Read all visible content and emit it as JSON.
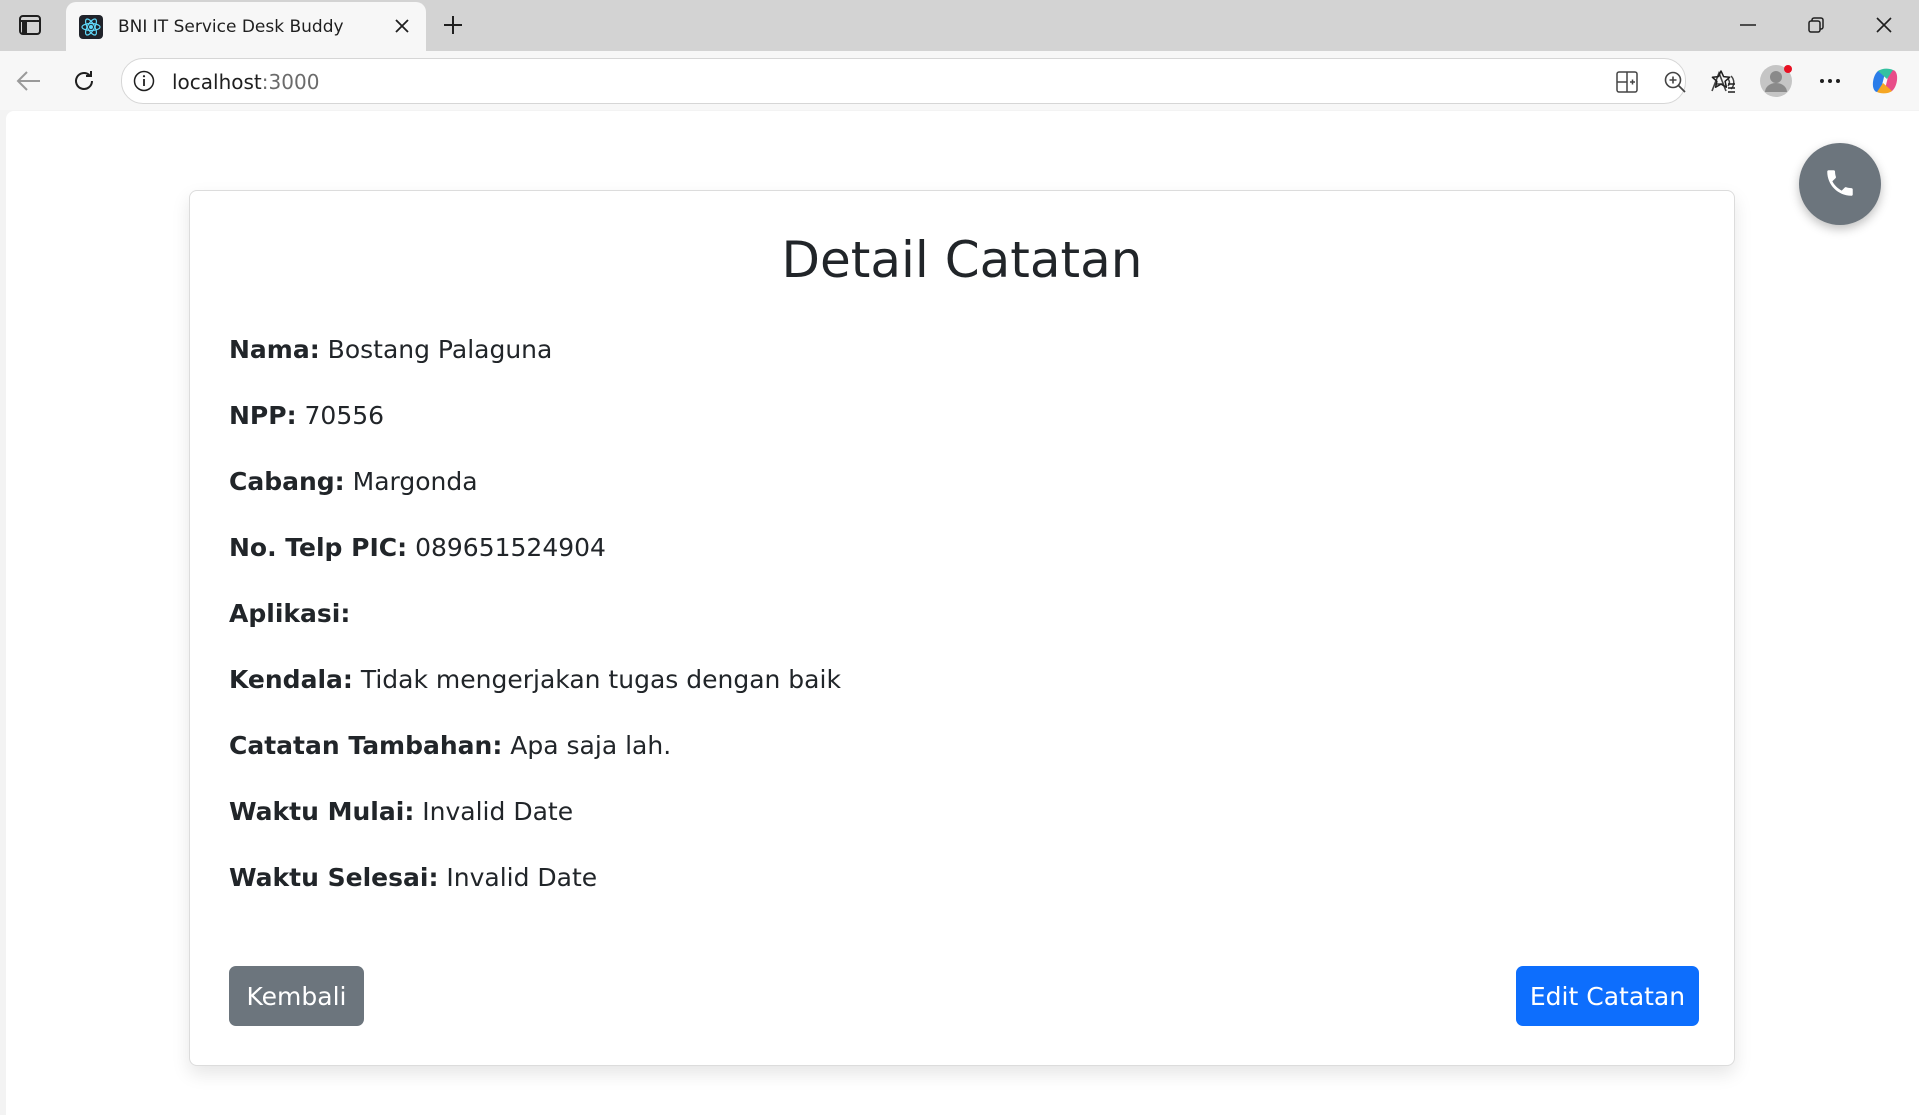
{
  "browser": {
    "tab_title": "BNI IT Service Desk Buddy",
    "url_host": "localhost",
    "url_port": ":3000"
  },
  "page": {
    "title": "Detail Catatan",
    "fields": [
      {
        "label": "Nama:",
        "value": "Bostang Palaguna"
      },
      {
        "label": "NPP:",
        "value": "70556"
      },
      {
        "label": "Cabang:",
        "value": "Margonda"
      },
      {
        "label": "No. Telp PIC:",
        "value": "089651524904"
      },
      {
        "label": "Aplikasi:",
        "value": ""
      },
      {
        "label": "Kendala:",
        "value": "Tidak mengerjakan tugas dengan baik"
      },
      {
        "label": "Catatan Tambahan:",
        "value": "Apa saja lah."
      },
      {
        "label": "Waktu Mulai:",
        "value": "Invalid Date"
      },
      {
        "label": "Waktu Selesai:",
        "value": "Invalid Date"
      }
    ],
    "back_button_label": "Kembali",
    "edit_button_label": "Edit Catatan"
  },
  "colors": {
    "primary_button": "#0d6efd",
    "secondary_button": "#6c757d",
    "call_button": "#6c757d"
  },
  "icons": {
    "call_button": "phone-icon"
  }
}
